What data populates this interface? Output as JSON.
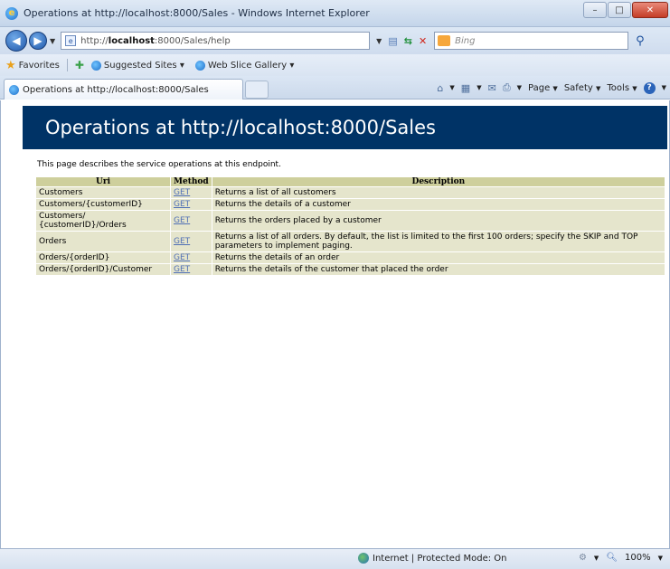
{
  "window": {
    "title": "Operations at http://localhost:8000/Sales - Windows Internet Explorer",
    "minimize": "–",
    "maximize": "□",
    "close": "✕"
  },
  "address_bar": {
    "url_prefix": "http://",
    "url_host": "localhost",
    "url_rest": ":8000/Sales/help",
    "search_placeholder": "Bing"
  },
  "favorites_bar": {
    "favorites_label": "Favorites",
    "items": [
      "Suggested Sites ▾",
      "Web Slice Gallery ▾"
    ]
  },
  "tab": {
    "label": "Operations at http://localhost:8000/Sales"
  },
  "command_bar": {
    "page_label": "Page",
    "safety_label": "Safety",
    "tools_label": "Tools"
  },
  "page": {
    "heading": "Operations at http://localhost:8000/Sales",
    "intro": "This page describes the service operations at this endpoint.",
    "columns": [
      "Uri",
      "Method",
      "Description"
    ],
    "rows": [
      {
        "uri": "Customers",
        "method": "GET",
        "description": "Returns a list of all customers"
      },
      {
        "uri": "Customers/{customerID}",
        "method": "GET",
        "description": "Returns the details of a customer"
      },
      {
        "uri": "Customers/\n{customerID}/Orders",
        "method": "GET",
        "description": "Returns the orders placed by a customer"
      },
      {
        "uri": "Orders",
        "method": "GET",
        "description": "Returns a list of all orders. By default, the list is limited to the first 100 orders; specify the SKIP and TOP parameters to implement paging."
      },
      {
        "uri": "Orders/{orderID}",
        "method": "GET",
        "description": "Returns the details of an order"
      },
      {
        "uri": "Orders/{orderID}/Customer",
        "method": "GET",
        "description": "Returns the details of the customer that placed the order"
      }
    ]
  },
  "status_bar": {
    "zone": "Internet | Protected Mode: On",
    "zoom": "100%"
  }
}
